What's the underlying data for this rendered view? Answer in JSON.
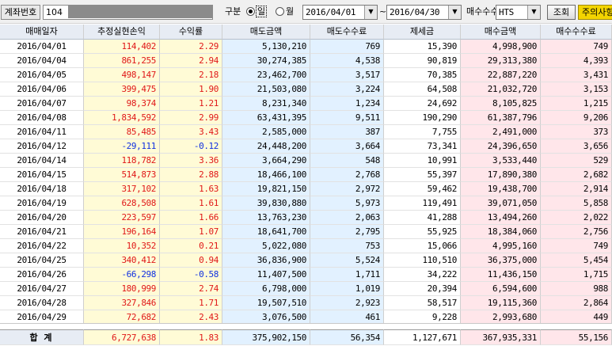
{
  "toolbar": {
    "account_label": "계좌번호",
    "account_prefix": "104",
    "period_label": "구분",
    "radio_daily": "일",
    "radio_monthly": "월",
    "date_from": "2016/04/01",
    "date_sep": "~",
    "date_to": "2016/04/30",
    "fee_label": "매수수수료",
    "fee_type": "HTS",
    "inquiry_button": "조회",
    "caution_button": "주의사항"
  },
  "table": {
    "columns": [
      "매매일자",
      "추정실현손익",
      "수익률",
      "매도금액",
      "매도수수료",
      "제세금",
      "매수금액",
      "매수수수료"
    ],
    "rows": [
      [
        "2016/04/01",
        "114,402",
        "2.29",
        "5,130,210",
        "769",
        "15,390",
        "4,998,900",
        "749"
      ],
      [
        "2016/04/04",
        "861,255",
        "2.94",
        "30,274,385",
        "4,538",
        "90,819",
        "29,313,380",
        "4,393"
      ],
      [
        "2016/04/05",
        "498,147",
        "2.18",
        "23,462,700",
        "3,517",
        "70,385",
        "22,887,220",
        "3,431"
      ],
      [
        "2016/04/06",
        "399,475",
        "1.90",
        "21,503,080",
        "3,224",
        "64,508",
        "21,032,720",
        "3,153"
      ],
      [
        "2016/04/07",
        "98,374",
        "1.21",
        "8,231,340",
        "1,234",
        "24,692",
        "8,105,825",
        "1,215"
      ],
      [
        "2016/04/08",
        "1,834,592",
        "2.99",
        "63,431,395",
        "9,511",
        "190,290",
        "61,387,796",
        "9,206"
      ],
      [
        "2016/04/11",
        "85,485",
        "3.43",
        "2,585,000",
        "387",
        "7,755",
        "2,491,000",
        "373"
      ],
      [
        "2016/04/12",
        "-29,111",
        "-0.12",
        "24,448,200",
        "3,664",
        "73,341",
        "24,396,650",
        "3,656"
      ],
      [
        "2016/04/14",
        "118,782",
        "3.36",
        "3,664,290",
        "548",
        "10,991",
        "3,533,440",
        "529"
      ],
      [
        "2016/04/15",
        "514,873",
        "2.88",
        "18,466,100",
        "2,768",
        "55,397",
        "17,890,380",
        "2,682"
      ],
      [
        "2016/04/18",
        "317,102",
        "1.63",
        "19,821,150",
        "2,972",
        "59,462",
        "19,438,700",
        "2,914"
      ],
      [
        "2016/04/19",
        "628,508",
        "1.61",
        "39,830,880",
        "5,973",
        "119,491",
        "39,071,050",
        "5,858"
      ],
      [
        "2016/04/20",
        "223,597",
        "1.66",
        "13,763,230",
        "2,063",
        "41,288",
        "13,494,260",
        "2,022"
      ],
      [
        "2016/04/21",
        "196,164",
        "1.07",
        "18,641,700",
        "2,795",
        "55,925",
        "18,384,060",
        "2,756"
      ],
      [
        "2016/04/22",
        "10,352",
        "0.21",
        "5,022,080",
        "753",
        "15,066",
        "4,995,160",
        "749"
      ],
      [
        "2016/04/25",
        "340,412",
        "0.94",
        "36,836,900",
        "5,524",
        "110,510",
        "36,375,000",
        "5,454"
      ],
      [
        "2016/04/26",
        "-66,298",
        "-0.58",
        "11,407,500",
        "1,711",
        "34,222",
        "11,436,150",
        "1,715"
      ],
      [
        "2016/04/27",
        "180,999",
        "2.74",
        "6,798,000",
        "1,019",
        "20,394",
        "6,594,600",
        "988"
      ],
      [
        "2016/04/28",
        "327,846",
        "1.71",
        "19,507,510",
        "2,923",
        "58,517",
        "19,115,360",
        "2,864"
      ],
      [
        "2016/04/29",
        "72,682",
        "2.43",
        "3,076,500",
        "461",
        "9,228",
        "2,993,680",
        "449"
      ]
    ],
    "total": [
      "합 계",
      "6,727,638",
      "1.83",
      "375,902,150",
      "56,354",
      "1,127,671",
      "367,935,331",
      "55,156"
    ]
  },
  "colors": {
    "profit": "#e01818",
    "loss": "#1030e0",
    "header_bg": "#e7ecf4",
    "pnl_bg": "#fffbd6",
    "sell_bg": "#e2f1ff",
    "buy_bg": "#ffe6ea",
    "caution_button_bg": "#f3d400"
  }
}
